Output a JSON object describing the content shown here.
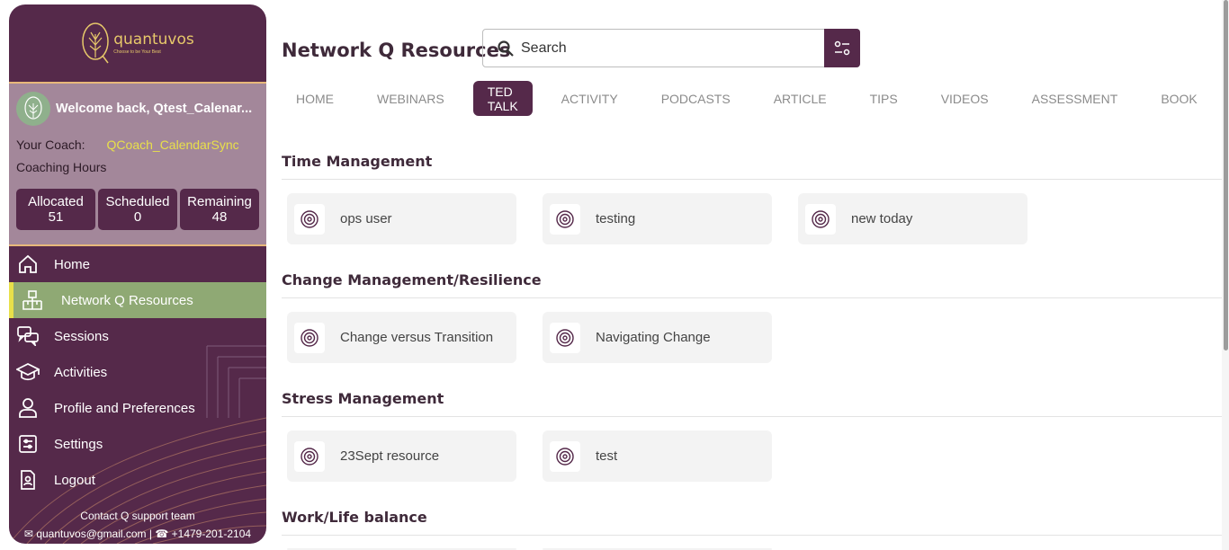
{
  "brand": {
    "name": "quantuvos",
    "tagline": "Choose to be Your Best"
  },
  "user": {
    "welcome": "Welcome back, Qtest_Calenar...",
    "coach_label": "Your Coach:",
    "coach_name": "QCoach_CalendarSync",
    "hours_title": "Coaching Hours"
  },
  "hours": [
    {
      "label": "Allocated",
      "value": "51"
    },
    {
      "label": "Scheduled",
      "value": "0"
    },
    {
      "label": "Remaining",
      "value": "48"
    }
  ],
  "nav": [
    {
      "label": "Home",
      "icon": "home-icon"
    },
    {
      "label": "Network Q Resources",
      "icon": "network-icon",
      "active": true
    },
    {
      "label": "Sessions",
      "icon": "chat-icon"
    },
    {
      "label": "Activities",
      "icon": "graduation-cap-icon"
    },
    {
      "label": "Profile and Preferences",
      "icon": "user-icon"
    },
    {
      "label": "Settings",
      "icon": "settings-icon"
    },
    {
      "label": "Logout",
      "icon": "logout-icon"
    }
  ],
  "contact": {
    "title": "Contact Q support team",
    "email": "quantuvos@gmail.com",
    "phone": "+1479-201-2104"
  },
  "main": {
    "title": "Network Q Resources",
    "search_placeholder": "Search"
  },
  "tabs": [
    {
      "label": "HOME"
    },
    {
      "label": "WEBINARS"
    },
    {
      "label": "TED TALK",
      "active": true
    },
    {
      "label": "ACTIVITY"
    },
    {
      "label": "PODCASTS"
    },
    {
      "label": "ARTICLE"
    },
    {
      "label": "TIPS"
    },
    {
      "label": "VIDEOS"
    },
    {
      "label": "ASSESSMENT"
    },
    {
      "label": "BOOK"
    }
  ],
  "sections": [
    {
      "title": "Time Management",
      "items": [
        "ops user",
        "testing",
        "new today"
      ]
    },
    {
      "title": "Change Management/Resilience",
      "items": [
        "Change versus Transition",
        "Navigating Change"
      ]
    },
    {
      "title": "Stress Management",
      "items": [
        "23Sept resource",
        "test"
      ]
    },
    {
      "title": "Work/Life balance",
      "items": []
    }
  ],
  "colors": {
    "primary": "#55294a",
    "accent_gold": "#e7c86a",
    "active_nav": "#8fa974",
    "coach_name": "#e8e04a"
  }
}
